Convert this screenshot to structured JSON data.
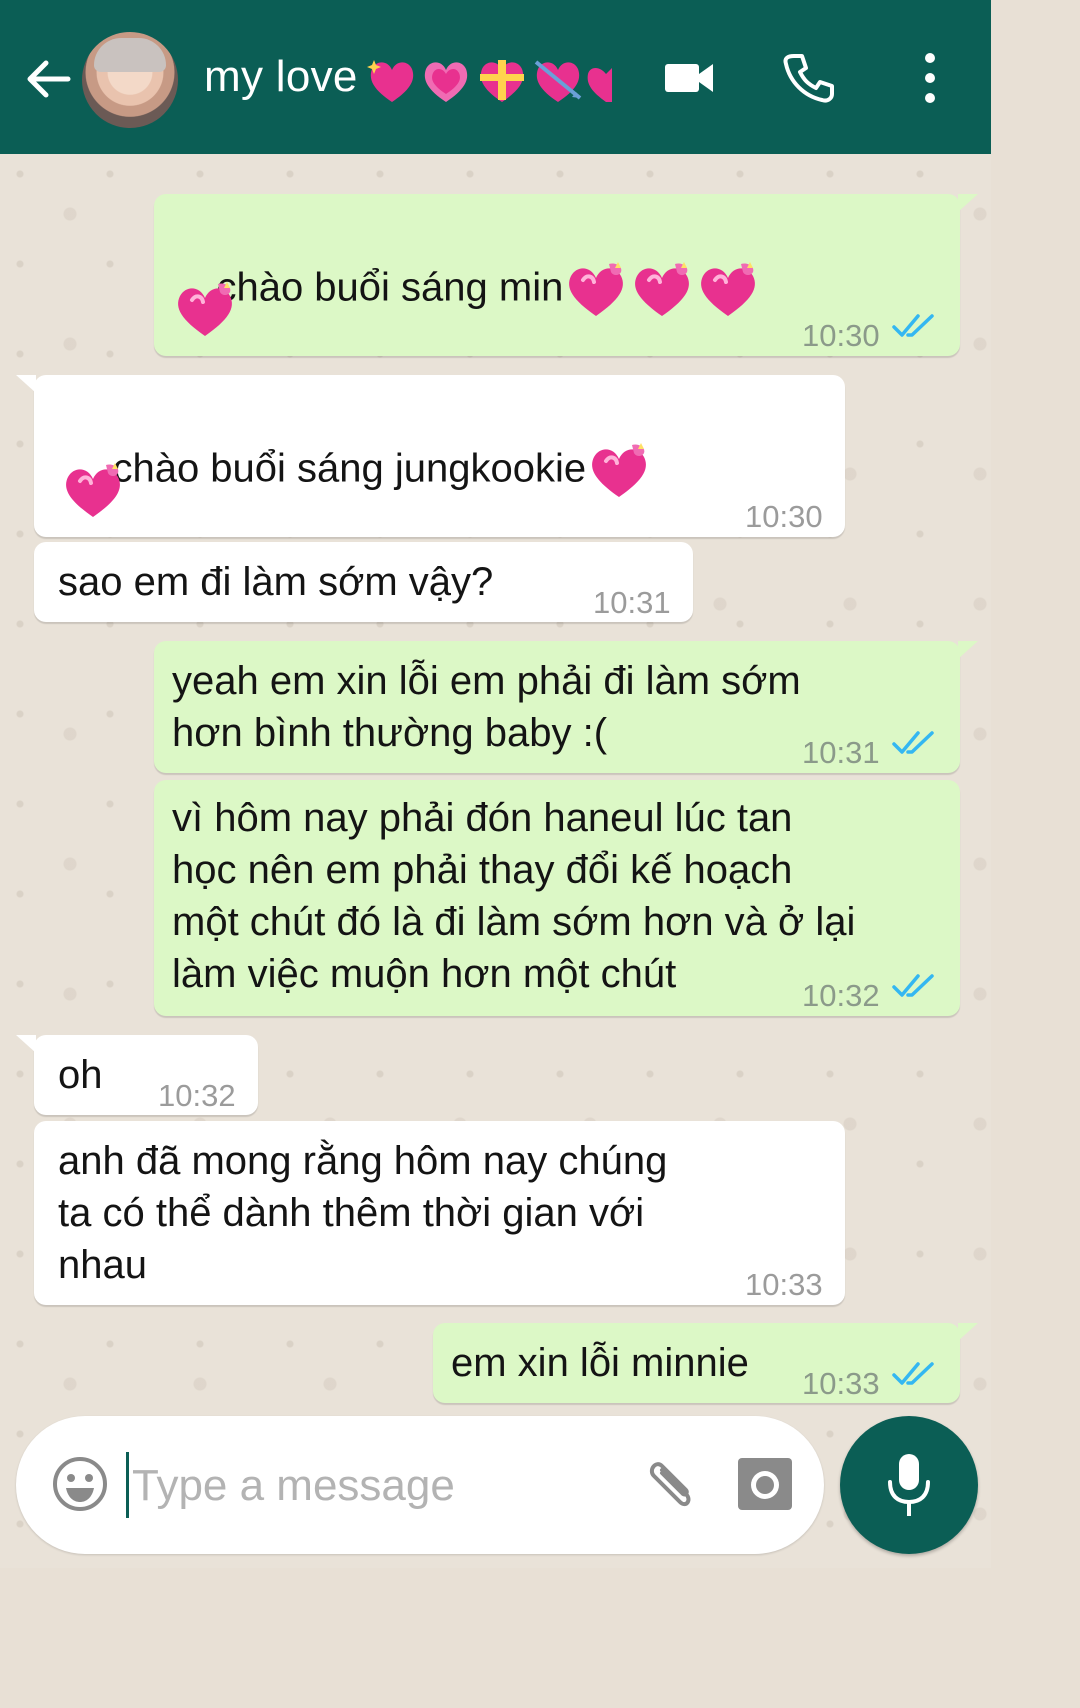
{
  "header": {
    "contact_name": "my love",
    "name_emojis": [
      "sparkling-heart",
      "growing-heart",
      "heart-with-ribbon",
      "heart-with-arrow",
      "heart"
    ]
  },
  "messages": [
    {
      "direction": "out",
      "text": "chào buổi sáng min",
      "emoji_hearts": 4,
      "time": "10:30",
      "read": true
    },
    {
      "direction": "in",
      "text": "chào buổi sáng jungkookie",
      "emoji_hearts": 2,
      "time": "10:30"
    },
    {
      "direction": "in",
      "text": "sao em đi làm sớm vậy?",
      "time": "10:31"
    },
    {
      "direction": "out",
      "text": "yeah em xin lỗi em phải đi làm sớm\nhơn bình thường baby :(",
      "time": "10:31",
      "read": true
    },
    {
      "direction": "out",
      "text": "vì hôm nay phải đón haneul lúc tan\nhọc nên em phải thay đổi kế hoạch\nmột chút đó là đi làm sớm hơn và ở lại\nlàm việc muộn hơn một chút",
      "time": "10:32",
      "read": true
    },
    {
      "direction": "in",
      "text": "oh",
      "time": "10:32"
    },
    {
      "direction": "in",
      "text": "anh đã mong rằng hôm nay chúng\nta có thể dành thêm thời gian với\nnhau",
      "time": "10:33"
    },
    {
      "direction": "out",
      "text": "em xin lỗi minnie",
      "time": "10:33",
      "read": true
    }
  ],
  "input": {
    "placeholder": "Type a message"
  },
  "colors": {
    "header": "#0b5e55",
    "outgoing_bubble": "#dcf8c6",
    "incoming_bubble": "#ffffff",
    "read_ticks": "#34b7f1"
  },
  "icons": [
    "back-arrow-icon",
    "video-call-icon",
    "phone-icon",
    "more-options-icon",
    "emoji-icon",
    "attach-icon",
    "camera-icon",
    "mic-icon"
  ]
}
